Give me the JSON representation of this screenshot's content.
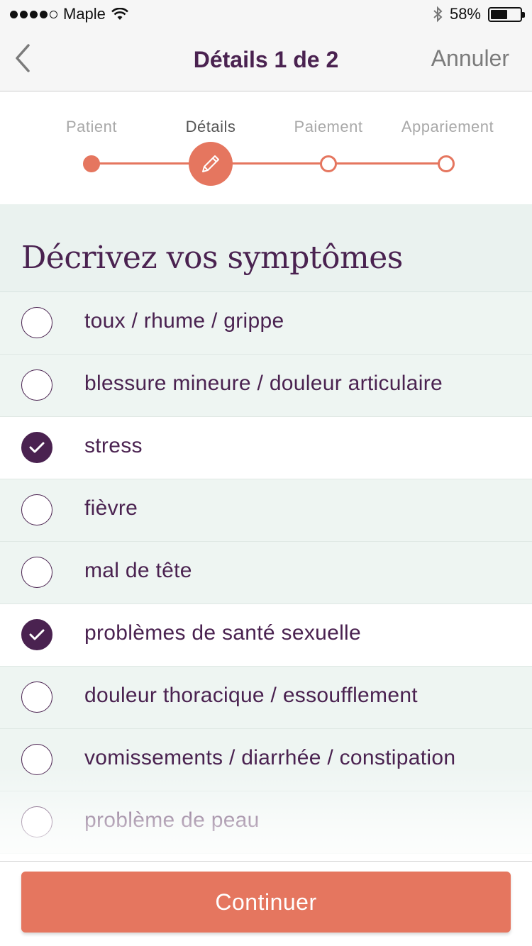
{
  "status_bar": {
    "carrier": "Maple",
    "battery_text": "58%",
    "battery_level": 0.58
  },
  "nav": {
    "title": "Détails 1 de 2",
    "cancel_label": "Annuler",
    "back_icon": "chevron-left-icon"
  },
  "stepper": {
    "steps": [
      {
        "label": "Patient",
        "state": "done"
      },
      {
        "label": "Détails",
        "state": "current"
      },
      {
        "label": "Paiement",
        "state": "pending"
      },
      {
        "label": "Appariement",
        "state": "pending"
      }
    ],
    "current_icon": "pencil-icon",
    "accent_color": "#e5765f"
  },
  "section": {
    "title": "Décrivez vos symptômes"
  },
  "symptoms": [
    {
      "label": "toux / rhume / grippe",
      "checked": false
    },
    {
      "label": "blessure mineure / douleur articulaire",
      "checked": false
    },
    {
      "label": "stress",
      "checked": true
    },
    {
      "label": "fièvre",
      "checked": false
    },
    {
      "label": "mal de tête",
      "checked": false
    },
    {
      "label": "problèmes de santé sexuelle",
      "checked": true
    },
    {
      "label": "douleur thoracique / essoufflement",
      "checked": false
    },
    {
      "label": "vomissements / diarrhée / constipation",
      "checked": false
    },
    {
      "label": "problème de peau",
      "checked": false
    }
  ],
  "footer": {
    "continue_label": "Continuer"
  },
  "colors": {
    "primary_purple": "#4a2250",
    "accent_coral": "#e5765f",
    "list_background": "#eef5f2"
  }
}
